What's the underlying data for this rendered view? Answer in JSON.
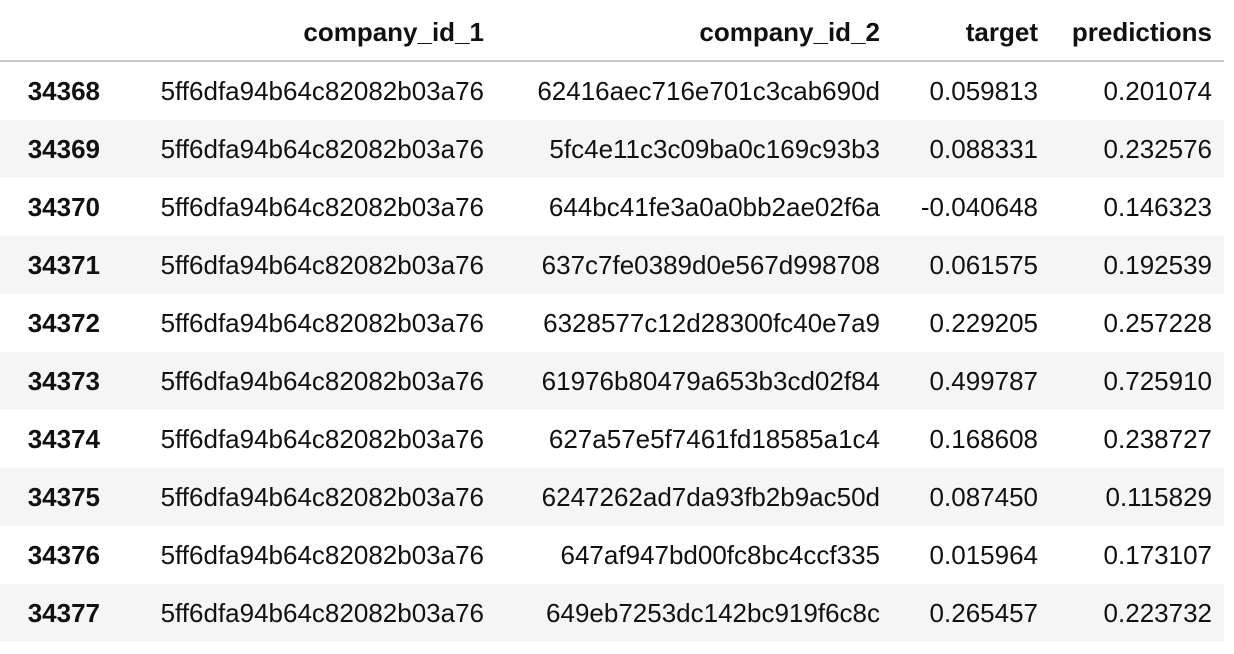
{
  "table": {
    "index_header": "",
    "columns": [
      "company_id_1",
      "company_id_2",
      "target",
      "predictions"
    ],
    "rows": [
      {
        "index": "34368",
        "company_id_1": "5ff6dfa94b64c82082b03a76",
        "company_id_2": "62416aec716e701c3cab690d",
        "target": "0.059813",
        "predictions": "0.201074"
      },
      {
        "index": "34369",
        "company_id_1": "5ff6dfa94b64c82082b03a76",
        "company_id_2": "5fc4e11c3c09ba0c169c93b3",
        "target": "0.088331",
        "predictions": "0.232576"
      },
      {
        "index": "34370",
        "company_id_1": "5ff6dfa94b64c82082b03a76",
        "company_id_2": "644bc41fe3a0a0bb2ae02f6a",
        "target": "-0.040648",
        "predictions": "0.146323"
      },
      {
        "index": "34371",
        "company_id_1": "5ff6dfa94b64c82082b03a76",
        "company_id_2": "637c7fe0389d0e567d998708",
        "target": "0.061575",
        "predictions": "0.192539"
      },
      {
        "index": "34372",
        "company_id_1": "5ff6dfa94b64c82082b03a76",
        "company_id_2": "6328577c12d28300fc40e7a9",
        "target": "0.229205",
        "predictions": "0.257228"
      },
      {
        "index": "34373",
        "company_id_1": "5ff6dfa94b64c82082b03a76",
        "company_id_2": "61976b80479a653b3cd02f84",
        "target": "0.499787",
        "predictions": "0.725910"
      },
      {
        "index": "34374",
        "company_id_1": "5ff6dfa94b64c82082b03a76",
        "company_id_2": "627a57e5f7461fd18585a1c4",
        "target": "0.168608",
        "predictions": "0.238727"
      },
      {
        "index": "34375",
        "company_id_1": "5ff6dfa94b64c82082b03a76",
        "company_id_2": "6247262ad7da93fb2b9ac50d",
        "target": "0.087450",
        "predictions": "0.115829"
      },
      {
        "index": "34376",
        "company_id_1": "5ff6dfa94b64c82082b03a76",
        "company_id_2": "647af947bd00fc8bc4ccf335",
        "target": "0.015964",
        "predictions": "0.173107"
      },
      {
        "index": "34377",
        "company_id_1": "5ff6dfa94b64c82082b03a76",
        "company_id_2": "649eb7253dc142bc919f6c8c",
        "target": "0.265457",
        "predictions": "0.223732"
      }
    ]
  },
  "colors": {
    "row_stripe": "#f5f5f5",
    "header_rule": "#c8c8c8",
    "text": "#111111"
  }
}
